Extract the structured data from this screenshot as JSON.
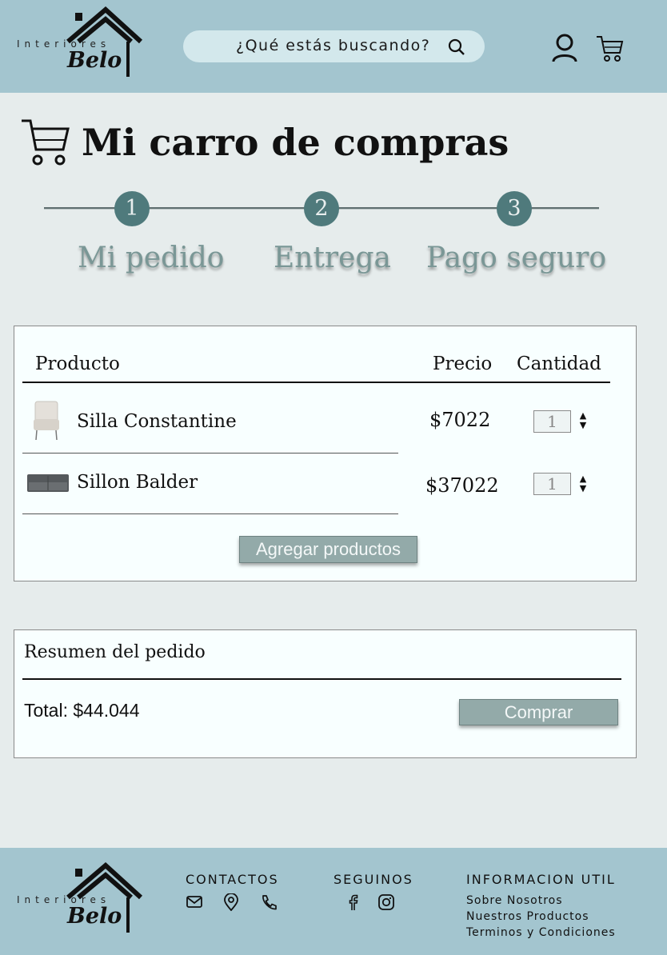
{
  "brand": {
    "top": "Interiores",
    "name": "Belo"
  },
  "search": {
    "placeholder": "¿Qué estás buscando?"
  },
  "page": {
    "title": "Mi carro de compras"
  },
  "steps": [
    {
      "number": "1",
      "label": "Mi pedido"
    },
    {
      "number": "2",
      "label": "Entrega"
    },
    {
      "number": "3",
      "label": "Pago seguro"
    }
  ],
  "cart": {
    "headers": {
      "product": "Producto",
      "price": "Precio",
      "quantity": "Cantidad"
    },
    "items": [
      {
        "name": "Silla Constantine",
        "price": "$7022",
        "quantity": "1",
        "image": "chair-thumbnail"
      },
      {
        "name": "Sillon Balder",
        "price": "$37022",
        "quantity": "1",
        "image": "sofa-thumbnail"
      }
    ],
    "add_button": "Agregar productos"
  },
  "summary": {
    "title": "Resumen del pedido",
    "total": "Total: $44.044",
    "buy_button": "Comprar"
  },
  "footer": {
    "contacts": {
      "heading": "CONTACTOS",
      "icons": [
        "mail-icon",
        "location-icon",
        "phone-icon"
      ]
    },
    "follow": {
      "heading": "SEGUINOS",
      "icons": [
        "facebook-icon",
        "instagram-icon"
      ]
    },
    "info": {
      "heading": "INFORMACION UTIL",
      "links": [
        "Sobre Nosotros",
        "Nuestros Productos",
        "Terminos y Condiciones"
      ]
    }
  },
  "colors": {
    "header_bg": "#a3c5cf",
    "page_bg": "#e6ecec",
    "accent": "#4f7a7c",
    "button": "#93aaa9"
  }
}
